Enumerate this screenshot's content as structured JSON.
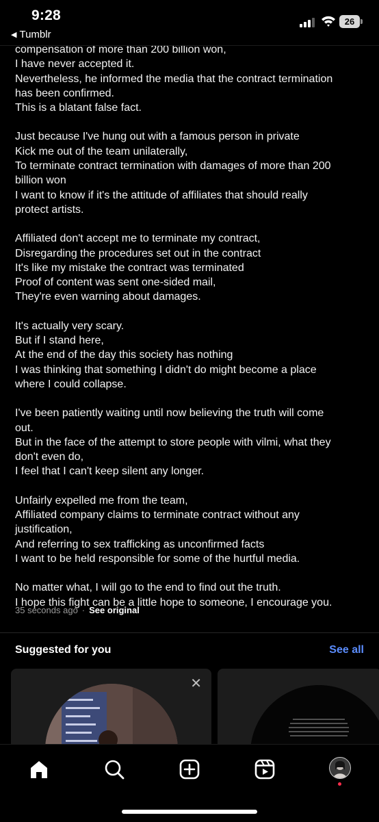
{
  "status_bar": {
    "time": "9:28",
    "back_app": "Tumblr",
    "battery": "26"
  },
  "article": {
    "paragraphs": [
      [
        "compensation of more than 200 billion won,",
        "I have never accepted it.",
        "Nevertheless, he informed the media that the contract termination",
        "has been confirmed.",
        "This is a blatant false fact."
      ],
      [
        "Just because I've hung out with a famous person in private",
        "Kick me out of the team unilaterally,",
        "To terminate contract termination with damages of more than 200",
        "billion won",
        "I want to know if it's the attitude of affiliates that should really",
        "protect artists."
      ],
      [
        "Affiliated don't accept me to terminate my contract,",
        "Disregarding the procedures set out in the contract",
        "It's like my mistake the contract was terminated",
        "Proof of content was sent one-sided mail,",
        "They're even warning about damages."
      ],
      [
        "It's actually very scary.",
        "But if I stand here,",
        "At the end of the day this society has nothing",
        "I was thinking that something I didn't do might become a place",
        "where I could collapse."
      ],
      [
        "I've been patiently waiting until now believing the truth will come",
        "out.",
        "But in the face of the attempt to store people with vilmi, what they",
        "don't even do,",
        "I feel that I can't keep silent any longer."
      ],
      [
        "Unfairly expelled me from the team,",
        "Affiliated company claims to terminate contract without any",
        "justification,",
        "And referring to sex trafficking as unconfirmed facts",
        "I want to be held responsible for some of the hurtful media."
      ],
      [
        "No matter what, I will go to the end to find out the truth.",
        "I hope this fight can be a little hope to someone, I encourage you."
      ]
    ],
    "timestamp": "35 seconds ago",
    "separator": "·",
    "see_original": "See original"
  },
  "suggested": {
    "title": "Suggested for you",
    "see_all": "See all",
    "close_label": "✕"
  },
  "tabbar": {
    "items": [
      "home-icon",
      "search-icon",
      "create-icon",
      "reels-icon",
      "profile-avatar"
    ]
  },
  "colors": {
    "background": "#000000",
    "link": "#5b8dff",
    "muted": "#9a9a9a",
    "notification": "#ff2d4b"
  }
}
